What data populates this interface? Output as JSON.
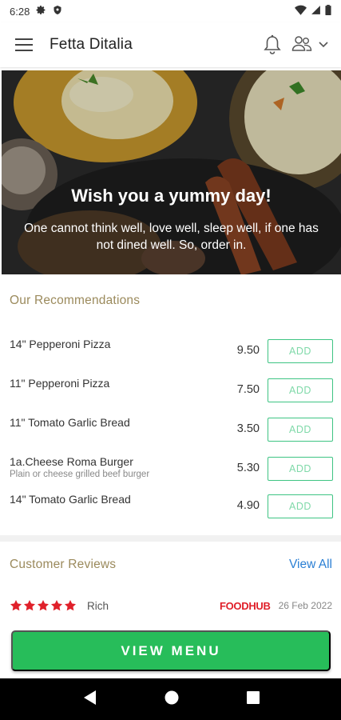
{
  "status_bar": {
    "time": "6:28",
    "icons": [
      "gear-icon",
      "shield-icon",
      "wifi-icon",
      "signal-icon",
      "battery-icon"
    ]
  },
  "app_bar": {
    "title": "Fetta Ditalia",
    "icons": [
      "menu-icon",
      "bell-icon",
      "user-group-icon",
      "chevron-down-icon"
    ]
  },
  "hero": {
    "title": "Wish you a yummy day!",
    "subtitle": "One cannot think well, love well, sleep well, if one has not dined well. So, order in."
  },
  "recommendations": {
    "title": "Our Recommendations",
    "add_label": "ADD",
    "items": [
      {
        "name": "14\" Pepperoni Pizza",
        "description": "",
        "price": "9.50"
      },
      {
        "name": "11\" Pepperoni Pizza",
        "description": "",
        "price": "7.50"
      },
      {
        "name": "11\" Tomato Garlic Bread",
        "description": "",
        "price": "3.50"
      },
      {
        "name": "1a.Cheese Roma Burger",
        "description": "Plain or cheese grilled beef burger",
        "price": "5.30"
      },
      {
        "name": "14\" Tomato Garlic Bread",
        "description": "",
        "price": "4.90"
      }
    ]
  },
  "reviews": {
    "title": "Customer Reviews",
    "view_all": "View All",
    "items": [
      {
        "rating": 5,
        "reviewer": "Rich",
        "source": "FOODHUB",
        "date": "26 Feb 2022"
      }
    ]
  },
  "view_menu_label": "VIEW MENU",
  "colors": {
    "accent_green": "#27bd5a",
    "section_title": "#9b8a5c",
    "link_blue": "#2a7fd4",
    "star_red": "#e0202a"
  },
  "nav_bar": {
    "icons": [
      "back-icon",
      "home-icon",
      "recents-icon"
    ]
  }
}
